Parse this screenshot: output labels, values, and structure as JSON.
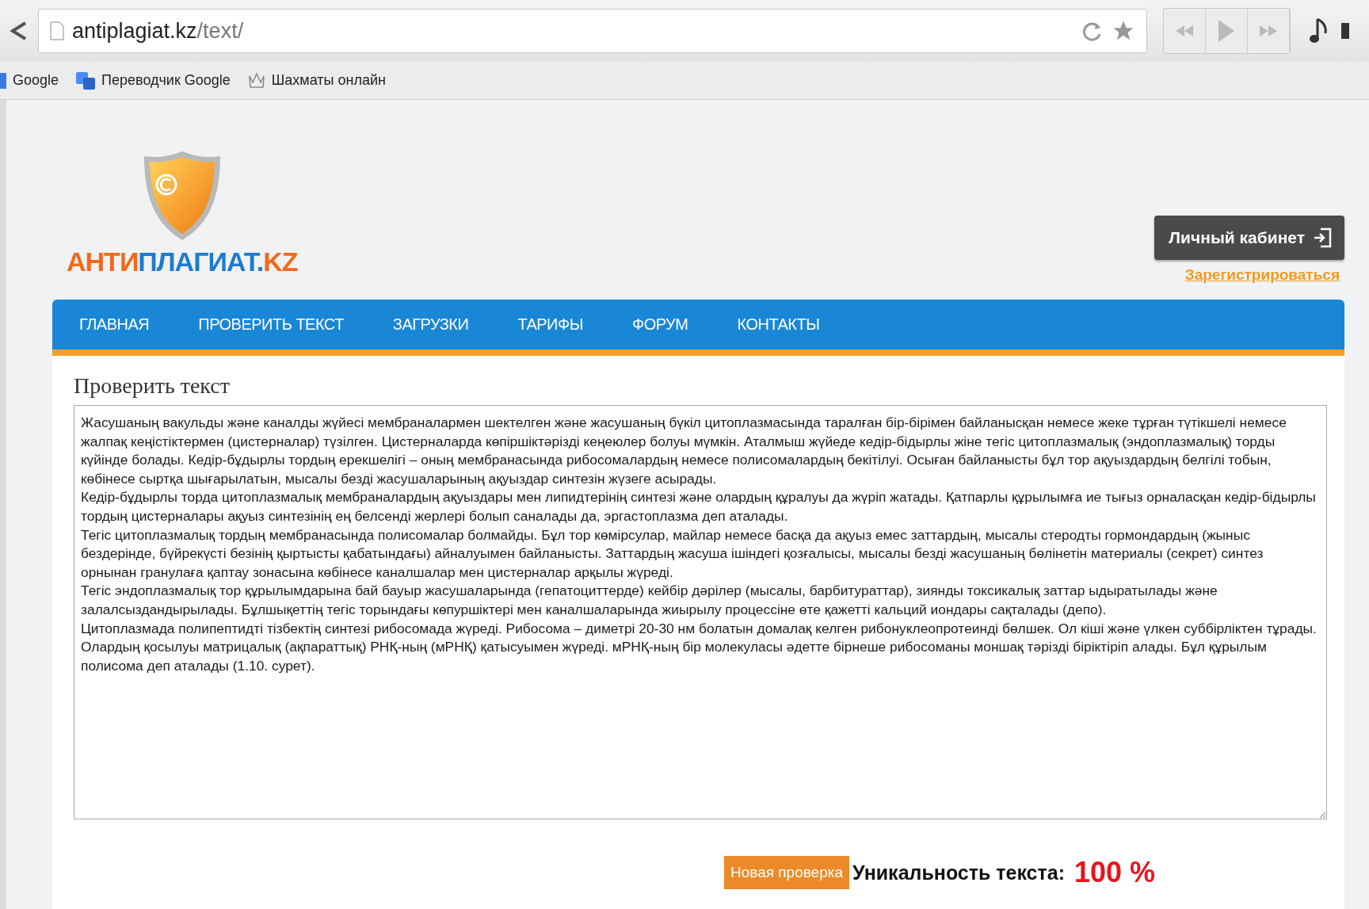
{
  "browser": {
    "url_host": "antiplagiat.kz",
    "url_path": "/text/",
    "bookmarks": [
      {
        "label": "Google",
        "kind": "google"
      },
      {
        "label": "Переводчик Google",
        "kind": "translate"
      },
      {
        "label": "Шахматы онлайн",
        "kind": "chess"
      }
    ]
  },
  "header": {
    "logo_parts": [
      {
        "text": "АНТИ",
        "color": "#f26a1b"
      },
      {
        "text": "ПЛАГИАТ.",
        "color": "#1c7ccf"
      },
      {
        "text": "KZ",
        "color": "#f26a1b"
      }
    ],
    "account_button": "Личный кабинет",
    "register_link": "Зарегистрироваться"
  },
  "nav": [
    {
      "label": "ГЛАВНАЯ",
      "selected": false
    },
    {
      "label": "ПРОВЕРИТЬ ТЕКСТ",
      "selected": false
    },
    {
      "label": "ЗАГРУЗКИ",
      "selected": false
    },
    {
      "label": "ТАРИФЫ",
      "selected": false
    },
    {
      "label": "ФОРУМ",
      "selected": false
    },
    {
      "label": "КОНТАКТЫ",
      "selected": false
    }
  ],
  "main": {
    "title": "Проверить текст",
    "text_paragraphs": [
      "Жасушаның вакульды және каналды жүйесі мембраналармен шектелген және жасушаның бүкіл цитоплазмасында таралған бір-бірімен байланысқан немесе жеке тұрған түтікшелі немесе жалпақ кеңістіктермен (цистерналар) түзілген. Цистерналарда көпіршіктәрізді кеңеюлер болуы мүмкін. Аталмыш жүйеде кедір-бідырлы жіне тегіс цитоплазмалық (эндоплазмалық) торды күйінде болады. Кедір-бұдырлы тордың ерекшелігі – оның мембранасында рибосомалардың немесе полисомалардың бекітілуі. Осыған байланысты бұл тор ақуыздардың белгілі тобын, көбінесе сыртқа шығарылатын, мысалы безді жасушаларының ақуыздар синтезін жүзеге асырады.",
      "Кедір-бұдырлы торда цитоплазмалық мембраналардың ақуыздары мен липидтерінің синтезі және олардың құралуы да жүріп жатады. Қатпарлы құрылымға ие тығыз орналасқан кедір-бідырлы тордың цистерналары ақуыз синтезінің ең белсенді жерлері болып саналады да, эргастоплазма деп аталады.",
      "Тегіс цитоплазмалық тордың мембранасында полисомалар болмайды. Бұл тор көмірсулар, майлар немесе басқа да ақуыз емес заттардың, мысалы стеродты гормондардың (жыныс бездерінде, бүйрекүсті безінің қыртысты қабатындағы) айналуымен байланысты. Заттардың жасуша ішіндегі қозғалысы, мысалы безді жасушаның бөлінетін материалы (секрет) синтез орнынан гранулаға қаптау зонасына көбінесе каналшалар мен цистерналар арқылы жүреді.",
      "Тегіс эндоплазмалық тор құрылымдарына бай бауыр жасушаларында (гепатоциттерде) кейбір дәрілер (мысалы, барбитураттар), зиянды токсикалық заттар ыдыратылады және залалсыздандырылады. Бұлшықеттің тегіс торындағы көпуршіктері мен каналшаларында жиырылу процессіне өте қажетті кальций иондары сақталады (депо).",
      "Цитоплазмада полипептидті тізбектің синтезі рибосомада жүреді. Рибосома – диметрі 20-30 нм болатын домалақ келген рибонуклеопротеинді бөлшек. Ол кіші және үлкен суббірліктен тұрады. Олардың қосылуы матрицалық (ақпараттық) РНҚ-ның (мРНҚ) қатысуымен жүреді. мРНҚ-ның бір молекуласы әдетте бірнеше рибосоманы моншақ тәрізді біріктіріп алады. Бұл құрылым полисома деп аталады (1.10. сурет)."
    ],
    "new_check_button": "Новая проверка",
    "uniqueness_label": "Уникальность текста:",
    "uniqueness_value": "100 %"
  }
}
